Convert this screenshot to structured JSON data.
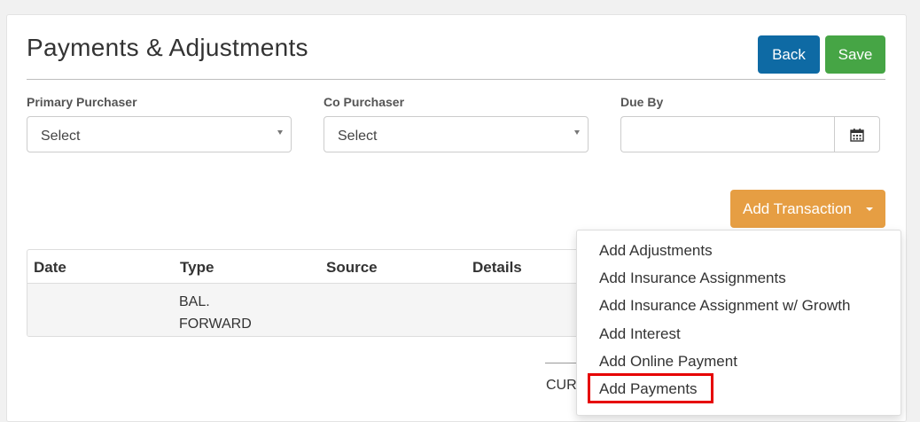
{
  "page": {
    "title": "Payments & Adjustments"
  },
  "header_buttons": {
    "back": "Back",
    "save": "Save"
  },
  "fields": {
    "primary_purchaser": {
      "label": "Primary Purchaser",
      "value": "Select"
    },
    "co_purchaser": {
      "label": "Co Purchaser",
      "value": "Select"
    },
    "due_by": {
      "label": "Due By",
      "value": "",
      "icon": "calendar-icon"
    }
  },
  "add_transaction": {
    "label": "Add Transaction"
  },
  "table": {
    "columns": [
      "Date",
      "Type",
      "Source",
      "Details"
    ],
    "rows": [
      {
        "date": "",
        "type": "BAL. FORWARD",
        "source": "",
        "details": ""
      }
    ]
  },
  "footer": {
    "partial_text": "CUR"
  },
  "dropdown_menu": {
    "items": [
      "Add Adjustments",
      "Add Insurance Assignments",
      "Add Insurance Assignment w/ Growth",
      "Add Interest",
      "Add Online Payment",
      "Add Payments"
    ],
    "highlighted_item": "Add Payments",
    "highlight_color": "#e60000"
  },
  "colors": {
    "back_button": "#0e6aa4",
    "save_button": "#46a545",
    "add_transaction_button": "#e69e43"
  }
}
